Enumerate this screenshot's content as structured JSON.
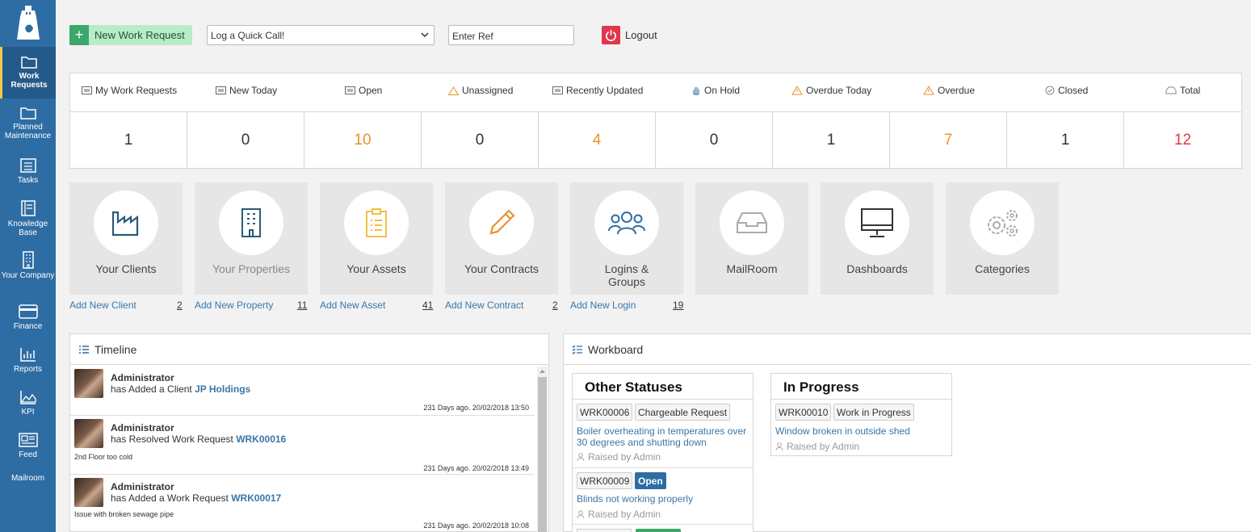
{
  "sidebar": {
    "items": [
      {
        "label": "Work Requests",
        "icon": "folder-icon"
      },
      {
        "label": "Planned Maintenance",
        "icon": "folder-icon"
      },
      {
        "label": "Tasks",
        "icon": "list-icon"
      },
      {
        "label": "Knowledge Base",
        "icon": "book-icon"
      },
      {
        "label": "Your Company",
        "icon": "building-icon"
      },
      {
        "label": "Finance",
        "icon": "card-icon"
      },
      {
        "label": "Reports",
        "icon": "bar-chart-icon"
      },
      {
        "label": "KPI",
        "icon": "area-chart-icon"
      },
      {
        "label": "Feed",
        "icon": "newspaper-icon"
      },
      {
        "label": "Mailroom",
        "icon": ""
      }
    ],
    "accent": "#f2c94c",
    "background": "#2e6da4"
  },
  "toolbar": {
    "new_request_label": "New Work Request",
    "quick_call_value": "Log a Quick Call!",
    "ref_placeholder": "Enter Ref",
    "logout_label": "Logout"
  },
  "stats": {
    "headers": [
      "My Work Requests",
      "New Today",
      "Open",
      "Unassigned",
      "Recently Updated",
      "On Hold",
      "Overdue Today",
      "Overdue",
      "Closed",
      "Total"
    ],
    "values": [
      "1",
      "0",
      "10",
      "0",
      "4",
      "0",
      "1",
      "7",
      "1",
      "12"
    ],
    "colors": {
      "orange": "#e8912c",
      "red": "#e0374a"
    }
  },
  "tiles": [
    {
      "label": "Your Clients",
      "link": "Add New Client",
      "count": "2"
    },
    {
      "label": "Your Properties",
      "link": "Add New Property",
      "count": "11"
    },
    {
      "label": "Your Assets",
      "link": "Add New Asset",
      "count": "41"
    },
    {
      "label": "Your Contracts",
      "link": "Add New Contract",
      "count": "2"
    },
    {
      "label": "Logins &\nGroups",
      "link": "Add New Login",
      "count": "19"
    },
    {
      "label": "MailRoom"
    },
    {
      "label": "Dashboards"
    },
    {
      "label": "Categories"
    }
  ],
  "timeline": {
    "title": "Timeline",
    "entries": [
      {
        "name": "Administrator",
        "action": "has Added a Client ",
        "link": "JP Holdings",
        "note": "",
        "time": "231 Days ago. 20/02/2018 13:50"
      },
      {
        "name": "Administrator",
        "action": "has Resolved Work Request ",
        "link": "WRK00016",
        "note": "2nd Floor too cold",
        "time": "231 Days ago. 20/02/2018 13:49"
      },
      {
        "name": "Administrator",
        "action": "has Added a Work Request ",
        "link": "WRK00017",
        "note": "Issue with broken sewage pipe",
        "time": "231 Days ago. 20/02/2018 10:08"
      }
    ]
  },
  "workboard": {
    "title": "Workboard",
    "columns": [
      {
        "title": "Other Statuses",
        "cards": [
          {
            "ref": "WRK00006",
            "status": "Chargeable Request",
            "desc": "Boiler overheating in temperatures over 30 degrees and shutting down",
            "raised": "Raised by Admin"
          },
          {
            "ref": "WRK00009",
            "status": "Open",
            "desc": "Blinds not working properly",
            "raised": "Raised by Admin"
          }
        ]
      },
      {
        "title": "In Progress",
        "cards": [
          {
            "ref": "WRK00010",
            "status": "Work in Progress",
            "desc": "Window broken in outside shed",
            "raised": "Raised by Admin"
          }
        ]
      }
    ]
  }
}
